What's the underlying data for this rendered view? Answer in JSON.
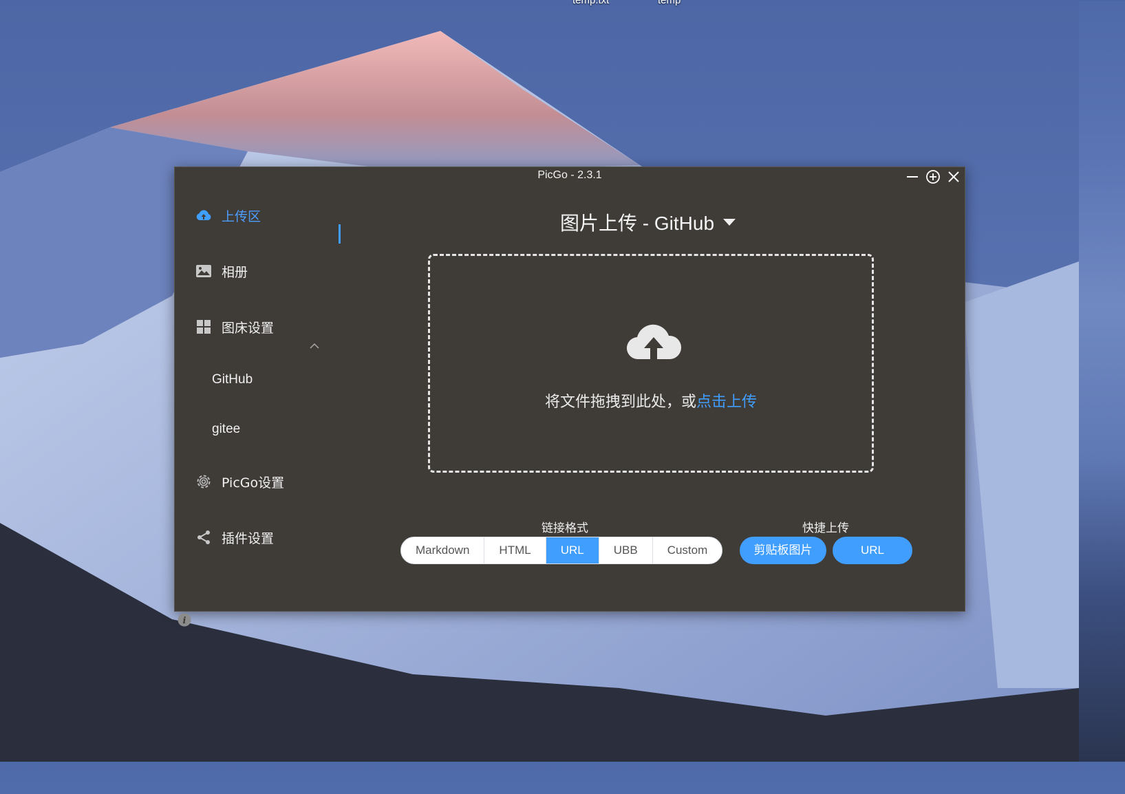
{
  "desktop": {
    "icon_labels": [
      "temp.txt",
      "temp"
    ]
  },
  "window": {
    "title": "PicGo - 2.3.1",
    "controls": {
      "minimize": "minimize-icon",
      "maximize": "plus-circle-icon",
      "close": "close-icon"
    }
  },
  "sidebar": {
    "items": [
      {
        "label": "上传区",
        "icon": "cloud-upload-icon",
        "active": true
      },
      {
        "label": "相册",
        "icon": "image-icon"
      },
      {
        "label": "图床设置",
        "icon": "grid-icon",
        "expanded": true
      },
      {
        "label": "PicGo设置",
        "icon": "gear-icon"
      },
      {
        "label": "插件设置",
        "icon": "share-icon"
      }
    ],
    "sub_items": [
      "GitHub",
      "gitee"
    ]
  },
  "main": {
    "heading": "图片上传 - GitHub",
    "dropzone": {
      "text": "将文件拖拽到此处，或",
      "link": "点击上传"
    },
    "link_format": {
      "label": "链接格式",
      "options": [
        "Markdown",
        "HTML",
        "URL",
        "UBB",
        "Custom"
      ],
      "selected": "URL"
    },
    "quick_upload": {
      "label": "快捷上传",
      "buttons": [
        "剪贴板图片",
        "URL"
      ]
    }
  },
  "colors": {
    "accent": "#409eff",
    "window_bg": "#3f3b37"
  }
}
